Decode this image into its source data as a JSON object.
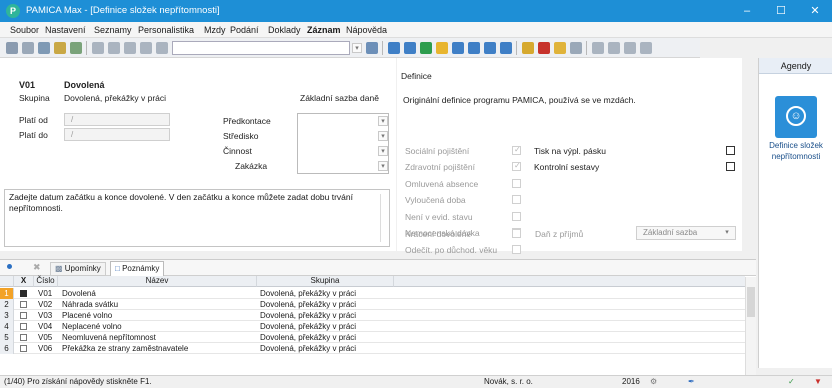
{
  "window": {
    "title": "PAMICA Max - [Definice složek nepřítomnosti]",
    "accent": "#1e8fd6"
  },
  "menu": [
    "Soubor",
    "Nastavení",
    "Seznamy",
    "Personalistika",
    "Mzdy",
    "Podání",
    "Doklady",
    "Záznam",
    "Nápověda"
  ],
  "record": {
    "code": "V01",
    "name": "Dovolená",
    "group_label": "Skupina",
    "group_value": "Dovolená, překážky v práci",
    "base_label": "Základní sazba daně",
    "valid_from_label": "Platí od",
    "valid_from_value": "/",
    "valid_to_label": "Platí do",
    "valid_to_value": "/",
    "predkontace_label": "Předkontace",
    "stredisko_label": "Středisko",
    "cinnost_label": "Činnost",
    "zakazka_label": "Zakázka",
    "hint": "Zadejte datum začátku a konce dovolené. V den začátku a konce můžete zadat dobu trvání nepřítomnosti."
  },
  "definice": {
    "title": "Definice",
    "text": "Originální definice programu PAMICA, používá se ve mzdách.",
    "options": [
      {
        "label": "Sociální pojištění",
        "checked": true
      },
      {
        "label": "Zdravotní pojištění",
        "checked": true
      },
      {
        "label": "Omluvená absence",
        "checked": false
      },
      {
        "label": "Vyloučená doba",
        "checked": false
      },
      {
        "label": "Není v evid. stavu",
        "checked": false
      },
      {
        "label": "Nemocenská dávka",
        "checked": false
      },
      {
        "label": "Odečít. po důchod. věku",
        "checked": false
      },
      {
        "label": "Krácení dovolené",
        "checked": false
      }
    ],
    "tisk_label": "Tisk na výpl. pásku",
    "kontrolni_label": "Kontrolní sestavy",
    "dan_label": "Daň z příjmů",
    "sazba_value": "Základní sazba"
  },
  "agendy": {
    "title": "Agendy",
    "item_label": "Definice složek nepřítomnosti"
  },
  "tabs": {
    "upominky": "Upomínky",
    "poznamky": "Poznámky"
  },
  "grid": {
    "headers": {
      "x": "X",
      "cislo": "Číslo",
      "nazev": "Název",
      "skupina": "Skupina"
    },
    "rows": [
      {
        "n": "1",
        "cislo": "V01",
        "nazev": "Dovolená",
        "skupina": "Dovolená, překážky v práci"
      },
      {
        "n": "2",
        "cislo": "V02",
        "nazev": "Náhrada svátku",
        "skupina": "Dovolená, překážky v práci"
      },
      {
        "n": "3",
        "cislo": "V03",
        "nazev": "Placené volno",
        "skupina": "Dovolená, překážky v práci"
      },
      {
        "n": "4",
        "cislo": "V04",
        "nazev": "Neplacené volno",
        "skupina": "Dovolená, překážky v práci"
      },
      {
        "n": "5",
        "cislo": "V05",
        "nazev": "Neomluvená nepřítomnost",
        "skupina": "Dovolená, překážky v práci"
      },
      {
        "n": "6",
        "cislo": "V06",
        "nazev": "Překážka ze strany zaměstnavatele",
        "skupina": "Dovolená, překážky v práci"
      }
    ]
  },
  "status": {
    "hint": "(1/40) Pro získání nápovědy stiskněte F1.",
    "company": "Novák, s. r. o.",
    "year": "2016"
  }
}
